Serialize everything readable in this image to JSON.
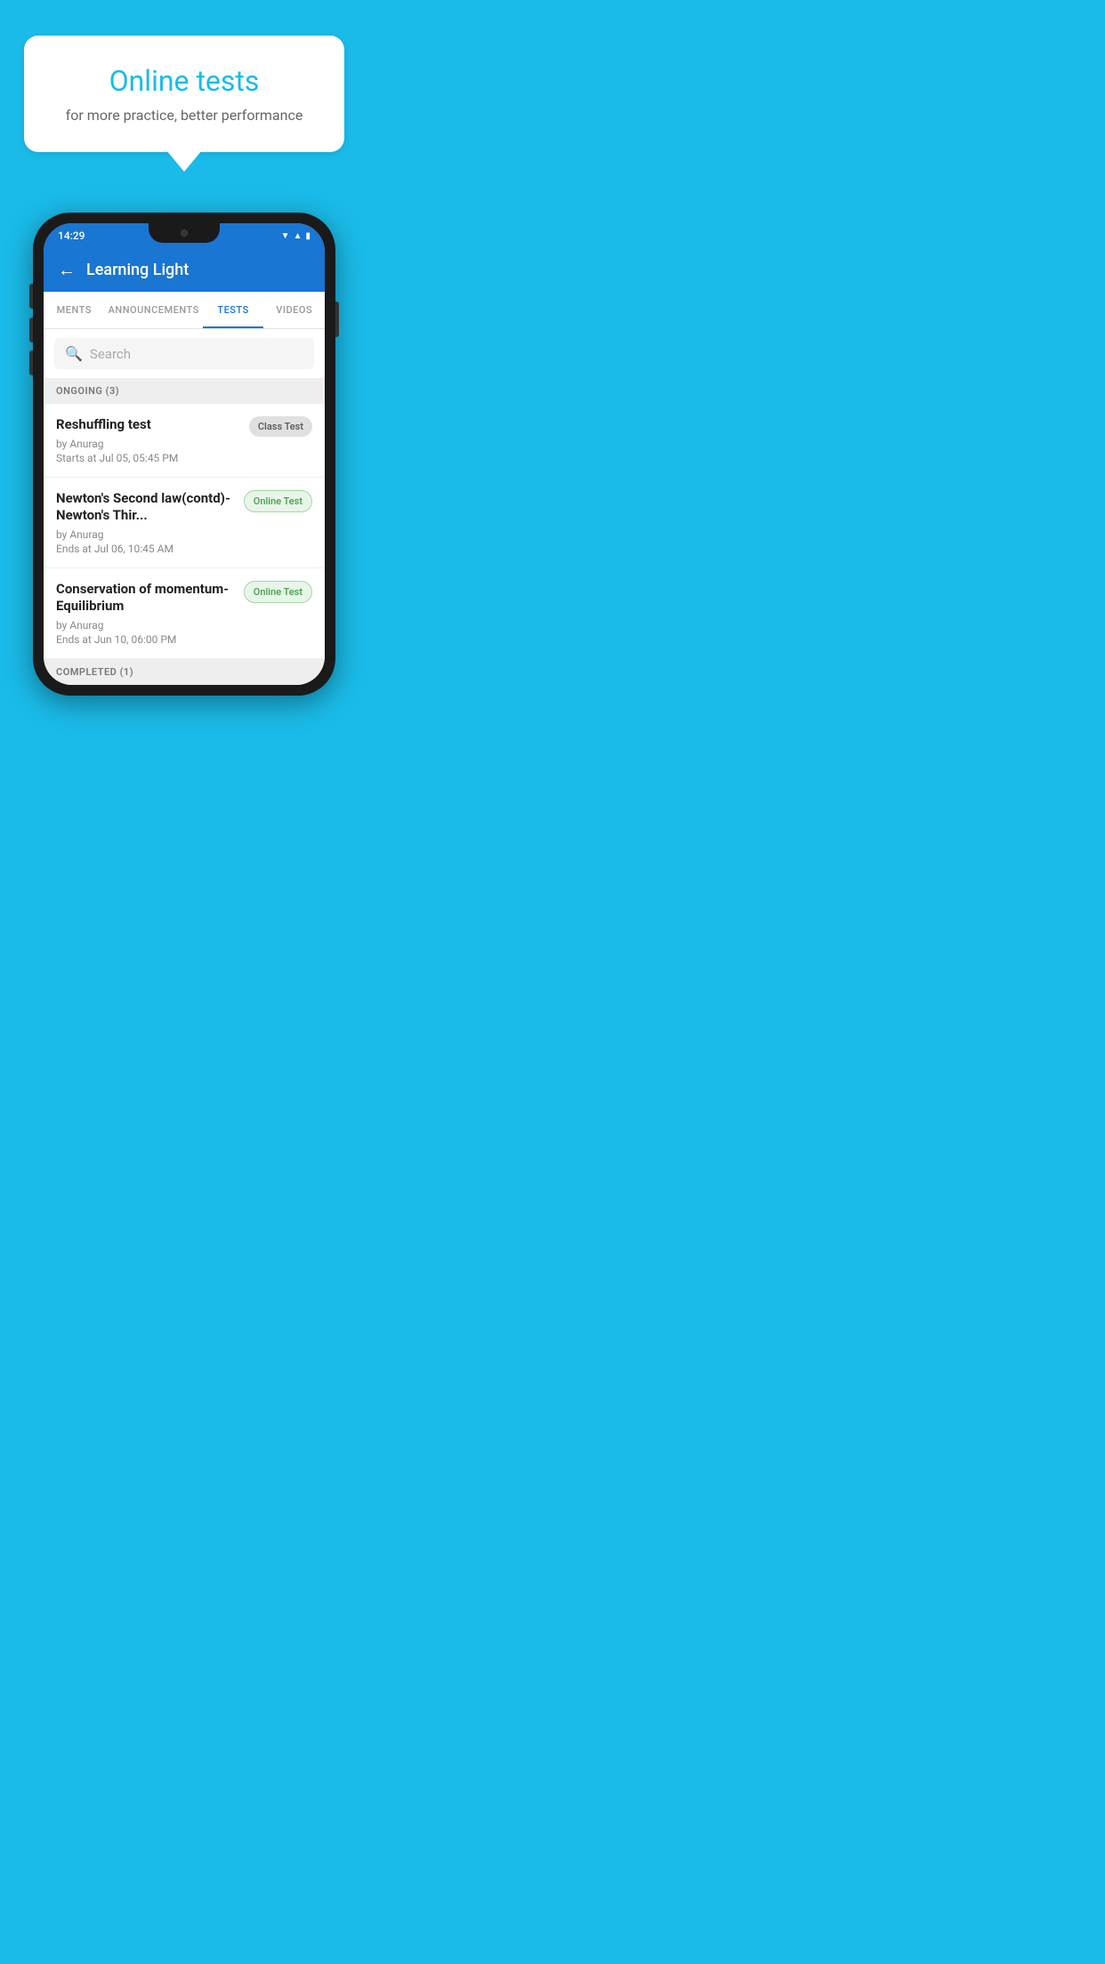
{
  "hero": {
    "bubble_title": "Online tests",
    "bubble_subtitle": "for more practice, better performance"
  },
  "phone": {
    "status_bar": {
      "time": "14:29",
      "signal_icon": "▲",
      "wifi_icon": "▼"
    },
    "app_header": {
      "back_label": "←",
      "title": "Learning Light"
    },
    "tabs": [
      {
        "label": "MENTS",
        "active": false
      },
      {
        "label": "ANNOUNCEMENTS",
        "active": false
      },
      {
        "label": "TESTS",
        "active": true
      },
      {
        "label": "VIDEOS",
        "active": false
      }
    ],
    "search": {
      "placeholder": "Search"
    },
    "ongoing_section": {
      "header": "ONGOING (3)",
      "tests": [
        {
          "name": "Reshuffling test",
          "by": "by Anurag",
          "date": "Starts at  Jul 05, 05:45 PM",
          "badge": "Class Test",
          "badge_type": "class"
        },
        {
          "name": "Newton's Second law(contd)-Newton's Thir...",
          "by": "by Anurag",
          "date": "Ends at  Jul 06, 10:45 AM",
          "badge": "Online Test",
          "badge_type": "online"
        },
        {
          "name": "Conservation of momentum-Equilibrium",
          "by": "by Anurag",
          "date": "Ends at  Jun 10, 06:00 PM",
          "badge": "Online Test",
          "badge_type": "online"
        }
      ]
    },
    "completed_section": {
      "header": "COMPLETED (1)"
    }
  }
}
